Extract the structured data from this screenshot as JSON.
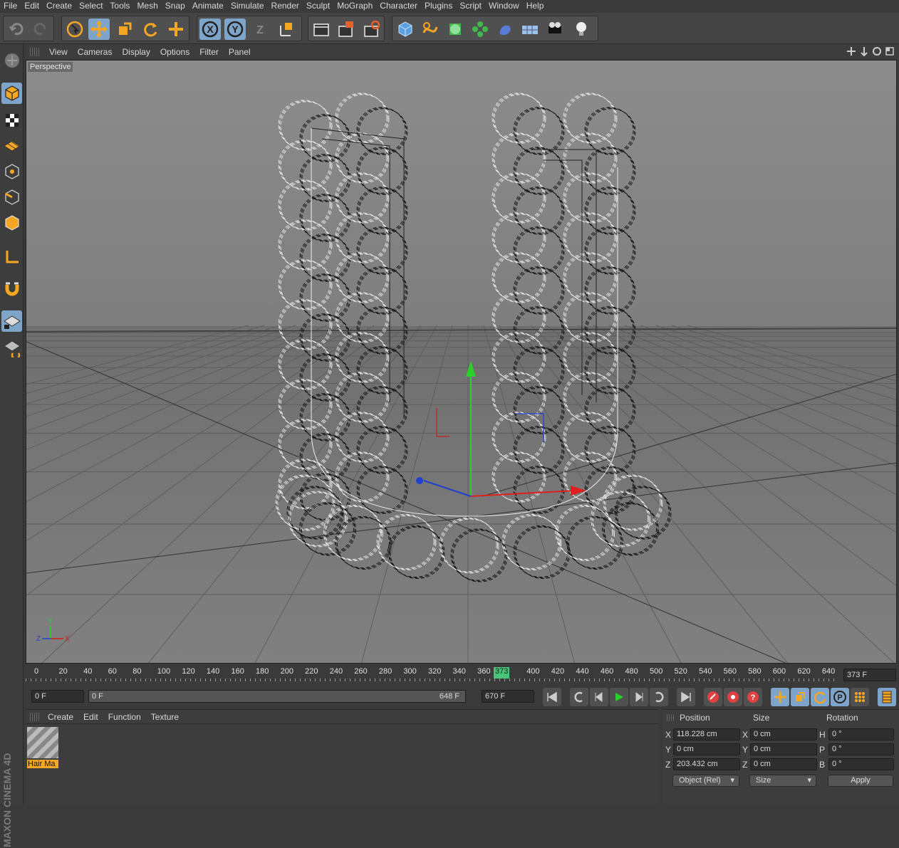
{
  "menubar": {
    "items": [
      "File",
      "Edit",
      "Create",
      "Select",
      "Tools",
      "Mesh",
      "Snap",
      "Animate",
      "Simulate",
      "Render",
      "Sculpt",
      "MoGraph",
      "Character",
      "Plugins",
      "Script",
      "Window",
      "Help"
    ]
  },
  "toolbar": {
    "undo_icon": "undo-icon",
    "redo_icon": "redo-icon",
    "tools": [
      "select-arrow-icon",
      "move-icon",
      "scale-icon",
      "rotate-icon",
      "add-icon"
    ],
    "axes": [
      "X",
      "Y",
      "Z"
    ],
    "render_icons": [
      "render-view-icon",
      "render-picture-viewer-icon",
      "edit-render-settings-icon"
    ],
    "create_icons": [
      "cube-icon",
      "spline-icon",
      "nurbs-icon",
      "array-icon",
      "deformer-icon",
      "scene-icon",
      "camera-icon",
      "light-icon"
    ]
  },
  "viewport": {
    "menu": [
      "View",
      "Cameras",
      "Display",
      "Options",
      "Filter",
      "Panel"
    ],
    "camera_label": "Perspective",
    "axis_labels": {
      "y": "Y",
      "z": "Z",
      "x": "X"
    }
  },
  "timeline": {
    "ticks": [
      "0",
      "20",
      "40",
      "60",
      "80",
      "100",
      "120",
      "140",
      "160",
      "180",
      "200",
      "220",
      "240",
      "260",
      "280",
      "300",
      "320",
      "340",
      "360",
      "400",
      "420",
      "440",
      "460",
      "480",
      "500",
      "520",
      "540",
      "560",
      "580",
      "600",
      "620",
      "640"
    ],
    "current_frame": "373",
    "current_frame_field": "373 F",
    "start_field": "0 F",
    "range_start": "0 F",
    "range_end": "648 F",
    "end_field": "670 F"
  },
  "materials": {
    "menu": [
      "Create",
      "Edit",
      "Function",
      "Texture"
    ],
    "items": [
      {
        "name": "Hair Ma"
      }
    ]
  },
  "attributes": {
    "headers": {
      "position": "Position",
      "size": "Size",
      "rotation": "Rotation"
    },
    "rows": [
      {
        "pos_axis": "X",
        "pos": "118.228 cm",
        "size_axis": "X",
        "size": "0 cm",
        "rot_axis": "H",
        "rot": "0 °"
      },
      {
        "pos_axis": "Y",
        "pos": "0 cm",
        "size_axis": "Y",
        "size": "0 cm",
        "rot_axis": "P",
        "rot": "0 °"
      },
      {
        "pos_axis": "Z",
        "pos": "203.432 cm",
        "size_axis": "Z",
        "size": "0 cm",
        "rot_axis": "B",
        "rot": "0 °"
      }
    ],
    "coord_mode": "Object (Rel)",
    "size_mode": "Size",
    "apply_label": "Apply"
  },
  "brand": "MAXON CINEMA 4D",
  "colors": {
    "accent_blue": "#7fa4c9",
    "accent_orange": "#f5a623",
    "frame_green": "#46c47a",
    "viewport_bg": "#848484"
  }
}
